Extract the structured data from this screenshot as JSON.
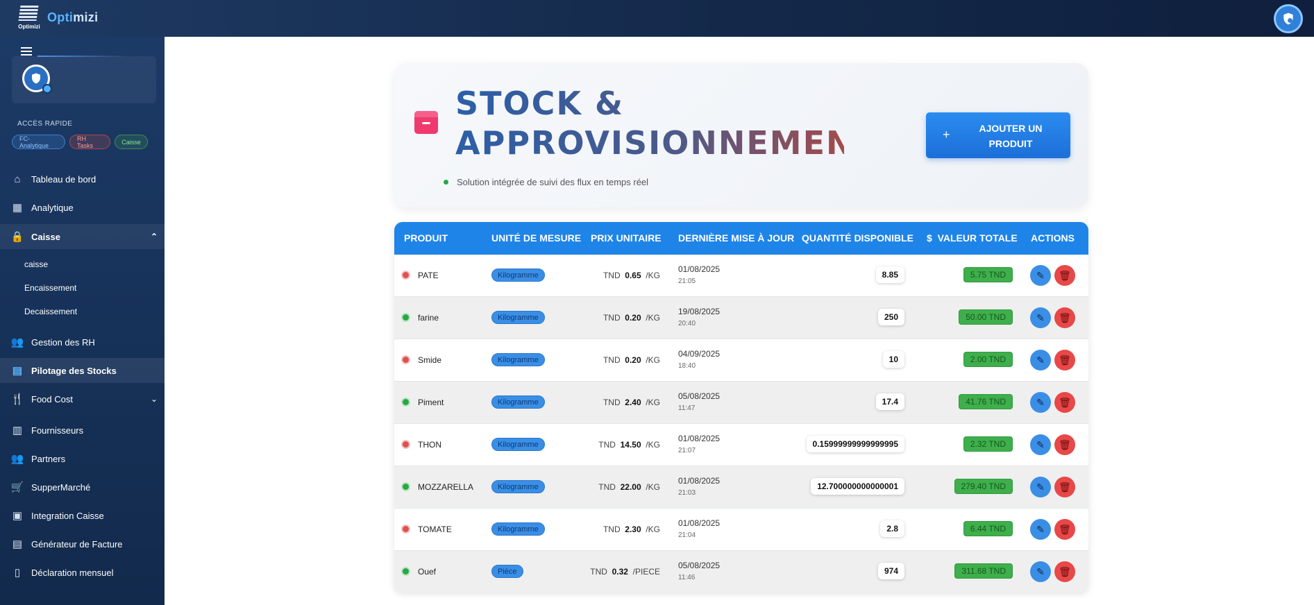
{
  "app": {
    "name_a": "Opti",
    "name_b": "mizi",
    "logo_text": "Optimizi"
  },
  "sidebar": {
    "quick_title": "ACCÈS RAPIDE",
    "chips": [
      "FC-Analytique",
      "RH Tasks",
      "Caisse"
    ],
    "items": [
      {
        "label": "Tableau de bord",
        "icon": "home-icon"
      },
      {
        "label": "Analytique",
        "icon": "chart-icon"
      },
      {
        "label": "Caisse",
        "icon": "lock-icon"
      },
      {
        "label": "Gestion des RH",
        "icon": "people-icon"
      },
      {
        "label": "Pilotage des Stocks",
        "icon": "store-icon"
      },
      {
        "label": "Food Cost",
        "icon": "fork-knife-icon"
      },
      {
        "label": "Fournisseurs",
        "icon": "building-icon"
      },
      {
        "label": "Partners",
        "icon": "people-icon"
      },
      {
        "label": "SupperMarché",
        "icon": "cart-icon"
      },
      {
        "label": "Integration Caisse",
        "icon": "register-icon"
      },
      {
        "label": "Générateur de Facture",
        "icon": "document-icon"
      },
      {
        "label": "Déclaration mensuel",
        "icon": "file-icon"
      }
    ],
    "caisse_sub": [
      "caisse",
      "Encaissement",
      "Decaissement"
    ]
  },
  "hero": {
    "title_line1": "STOCK &",
    "title_line2": "APPROVISIONNEMENT",
    "subtitle": "Solution intégrée de suivi des flux en temps réel",
    "add_button": "AJOUTER UN PRODUIT"
  },
  "table": {
    "headers": [
      "PRODUIT",
      "UNITÉ DE MESURE",
      "PRIX UNITAIRE",
      "DERNIÈRE MISE À JOUR",
      "QUANTITÉ DISPONIBLE",
      "VALEUR TOTALE",
      "ACTIONS"
    ],
    "rows": [
      {
        "status": "red",
        "name": "PATE",
        "unit": "Kilogramme",
        "currency": "TND",
        "price": "0.65",
        "per": "/KG",
        "date": "01/08/2025",
        "time": "21:05",
        "qty": "8.85",
        "value": "5.75 TND"
      },
      {
        "status": "green",
        "name": "farine",
        "unit": "Kilogramme",
        "currency": "TND",
        "price": "0.20",
        "per": "/KG",
        "date": "19/08/2025",
        "time": "20:40",
        "qty": "250",
        "value": "50.00 TND"
      },
      {
        "status": "red",
        "name": "Smide",
        "unit": "Kilogramme",
        "currency": "TND",
        "price": "0.20",
        "per": "/KG",
        "date": "04/09/2025",
        "time": "18:40",
        "qty": "10",
        "value": "2.00 TND"
      },
      {
        "status": "green",
        "name": "Piment",
        "unit": "Kilogramme",
        "currency": "TND",
        "price": "2.40",
        "per": "/KG",
        "date": "05/08/2025",
        "time": "11:47",
        "qty": "17.4",
        "value": "41.76 TND"
      },
      {
        "status": "red",
        "name": "THON",
        "unit": "Kilogramme",
        "currency": "TND",
        "price": "14.50",
        "per": "/KG",
        "date": "01/08/2025",
        "time": "21:07",
        "qty": "0.15999999999999995",
        "value": "2.32 TND"
      },
      {
        "status": "green",
        "name": "MOZZARELLA",
        "unit": "Kilogramme",
        "currency": "TND",
        "price": "22.00",
        "per": "/KG",
        "date": "01/08/2025",
        "time": "21:03",
        "qty": "12.700000000000001",
        "value": "279.40 TND"
      },
      {
        "status": "red",
        "name": "TOMATE",
        "unit": "Kilogramme",
        "currency": "TND",
        "price": "2.30",
        "per": "/KG",
        "date": "01/08/2025",
        "time": "21:04",
        "qty": "2.8",
        "value": "6.44 TND"
      },
      {
        "status": "green",
        "name": "Ouef",
        "unit": "Pièce",
        "currency": "TND",
        "price": "0.32",
        "per": "/PIECE",
        "date": "05/08/2025",
        "time": "11:46",
        "qty": "974",
        "value": "311.68 TND"
      }
    ]
  }
}
